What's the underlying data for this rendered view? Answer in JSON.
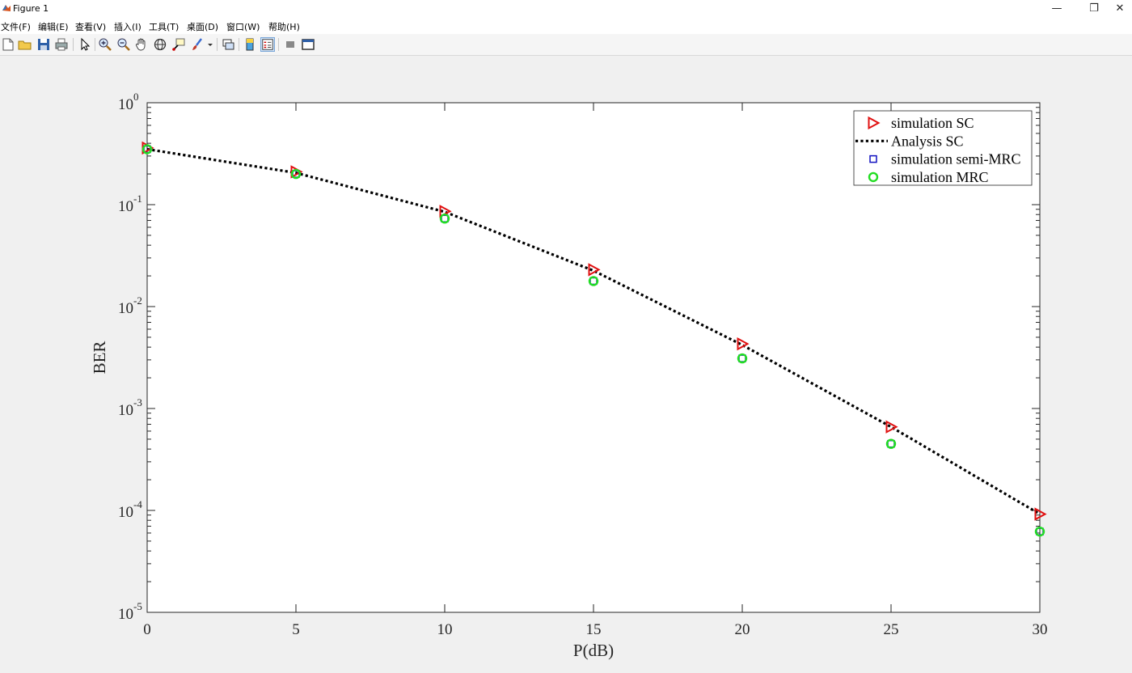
{
  "window": {
    "title": "Figure 1"
  },
  "menu": [
    "文件(F)",
    "编辑(E)",
    "查看(V)",
    "插入(I)",
    "工具(T)",
    "桌面(D)",
    "窗口(W)",
    "帮助(H)"
  ],
  "toolbar": [
    "new-file-icon",
    "open-folder-icon",
    "save-icon",
    "print-icon",
    "pointer-icon",
    "zoom-in-icon",
    "zoom-out-icon",
    "pan-hand-icon",
    "rotate-3d-icon",
    "data-cursor-icon",
    "brush-icon",
    "link-icon",
    "colorbar-icon",
    "legend-icon",
    "hide-tools-icon",
    "dock-icon"
  ],
  "chart_data": {
    "type": "scatter",
    "xlabel": "P(dB)",
    "ylabel": "BER",
    "xlim": [
      0,
      30
    ],
    "ylim": [
      1e-05,
      1
    ],
    "yscale": "log",
    "xticks": [
      "0",
      "5",
      "10",
      "15",
      "20",
      "25",
      "30"
    ],
    "yticks": [
      {
        "base": "10",
        "exp": "0"
      },
      {
        "base": "10",
        "exp": "-1"
      },
      {
        "base": "10",
        "exp": "-2"
      },
      {
        "base": "10",
        "exp": "-3"
      },
      {
        "base": "10",
        "exp": "-4"
      },
      {
        "base": "10",
        "exp": "-5"
      }
    ],
    "legend_position": "top-right",
    "x": [
      0,
      5,
      10,
      15,
      20,
      25,
      30
    ],
    "series": [
      {
        "name": "simulation SC",
        "marker": "triangle-right",
        "color": "#e01010",
        "line": "none",
        "values": [
          0.36,
          0.21,
          0.086,
          0.023,
          0.0043,
          0.00066,
          9.2e-05
        ]
      },
      {
        "name": "Analysis SC",
        "marker": "none",
        "color": "#000000",
        "line": "dotted",
        "values": [
          0.35,
          0.205,
          0.085,
          0.0225,
          0.0042,
          0.00066,
          9.2e-05
        ]
      },
      {
        "name": "simulation semi-MRC",
        "marker": "square",
        "color": "#1010c0",
        "line": "none",
        "values": [
          0.35,
          0.2,
          0.073,
          0.0178,
          0.0031,
          0.00045,
          6.2e-05
        ]
      },
      {
        "name": "simulation MRC",
        "marker": "circle",
        "color": "#22dd22",
        "line": "none",
        "values": [
          0.35,
          0.2,
          0.073,
          0.0178,
          0.0031,
          0.00045,
          6.2e-05
        ]
      }
    ]
  }
}
